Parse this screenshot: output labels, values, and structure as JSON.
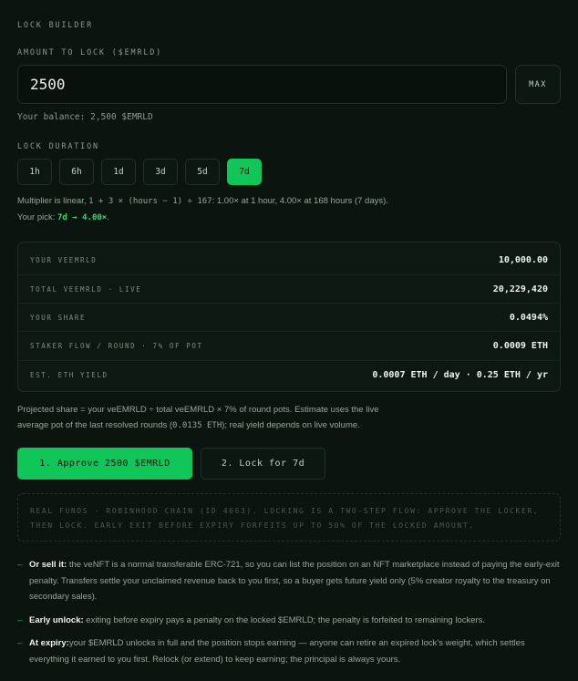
{
  "section_title": "LOCK BUILDER",
  "amount": {
    "label": "AMOUNT TO LOCK ($EMRLD)",
    "value": "2500",
    "max_label": "MAX",
    "balance": "Your balance: 2,500 $EMRLD"
  },
  "duration": {
    "label": "LOCK DURATION",
    "options": [
      "1h",
      "6h",
      "1d",
      "3d",
      "5d",
      "7d"
    ],
    "selected": "7d"
  },
  "multiplier_note": {
    "prefix": "Multiplier is linear, ",
    "formula": "1 + 3 × (hours − 1) ÷ 167",
    "suffix": ": 1.00× at 1 hour, 4.00× at 168 hours (7 days). Your pick: ",
    "pick": "7d → 4.00×",
    "end": "."
  },
  "stats": [
    {
      "label": "YOUR VEEMRLD",
      "value": "10,000.00"
    },
    {
      "label": "TOTAL VEEMRLD · LIVE",
      "value": "20,229,420"
    },
    {
      "label": "YOUR SHARE",
      "value": "0.0494%"
    },
    {
      "label": "STAKER FLOW / ROUND · 7% OF POT",
      "value": "0.0009 ETH"
    },
    {
      "label": "EST. ETH YIELD",
      "value": "0.0007 ETH / day · 0.25 ETH / yr"
    }
  ],
  "projection_note": {
    "prefix": "Projected share = your veEMRLD ÷ total veEMRLD × 7% of round pots. Estimate uses the live average pot of the last resolved rounds (",
    "pot": "0.0135 ETH",
    "suffix": "); real yield depends on live volume."
  },
  "buttons": {
    "approve": "1. Approve 2500 $EMRLD",
    "lock": "2. Lock for 7d"
  },
  "warning": "REAL FUNDS · ROBINHOOD CHAIN (ID 4663). LOCKING IS A TWO-STEP FLOW: APPROVE THE LOCKER, THEN LOCK. EARLY EXIT BEFORE EXPIRY FORFEITS UP TO 50% OF THE LOCKED AMOUNT.",
  "info": [
    {
      "dash": "–",
      "title": "Or sell it:",
      "text": " the veNFT is a normal transferable ERC-721, so you can list the position on an NFT marketplace instead of paying the early-exit penalty. Transfers settle your unclaimed revenue back to you first, so a buyer gets future yield only (5% creator royalty to the treasury on secondary sales)."
    },
    {
      "dash": "–",
      "title": "Early unlock:",
      "text": " exiting before expiry pays a penalty on the locked $EMRLD; the penalty is forfeited to remaining lockers."
    },
    {
      "dash": "–",
      "title": "At expiry:",
      "text": "your $EMRLD unlocks in full and the position stops earning — anyone can retire an expired lock’s weight, which settles everything it earned to you first. Relock (or extend) to keep earning; the principal is always yours."
    }
  ],
  "colors": {
    "background": "#0b140f",
    "accent": "#10c659",
    "accent_text": "#2fdc76"
  }
}
